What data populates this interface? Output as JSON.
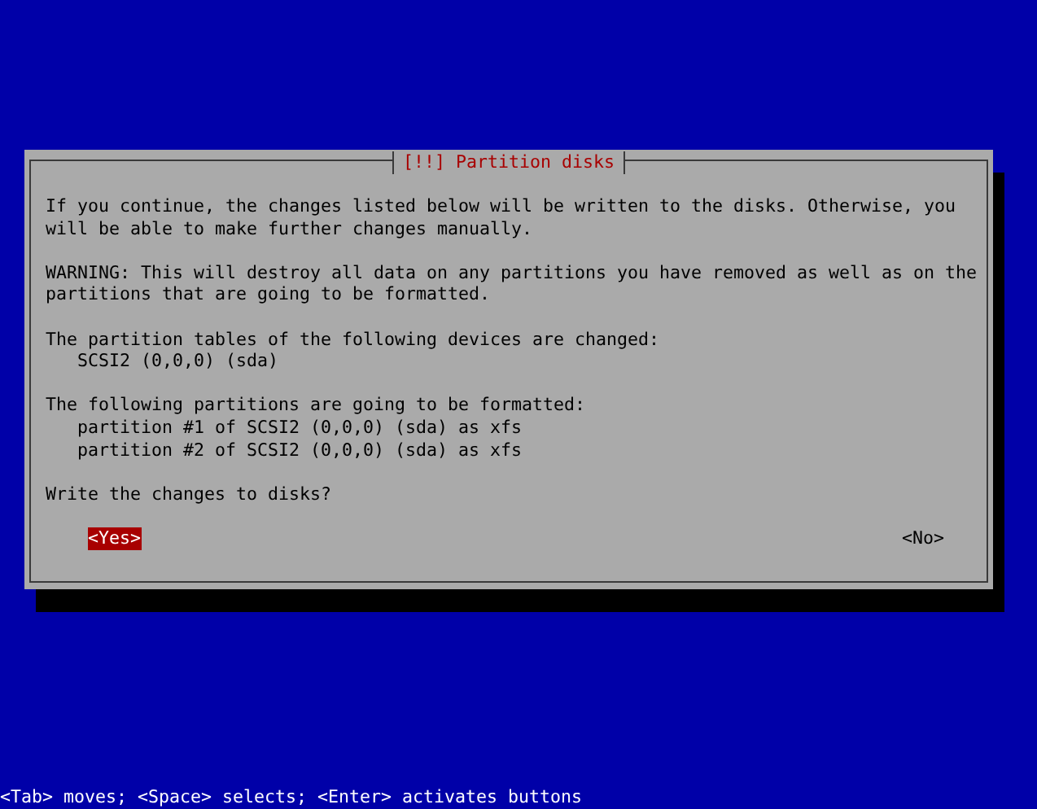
{
  "dialog": {
    "title": "[!!] Partition disks",
    "paragraphs": [
      {
        "kind": "text",
        "text": "If you continue, the changes listed below will be written to the disks. Otherwise, you will be able to make further changes manually."
      },
      {
        "kind": "text",
        "text": "WARNING: This will destroy all data on any partitions you have removed as well as on the partitions that are going to be formatted."
      },
      {
        "kind": "list",
        "heading": "The partition tables of the following devices are changed:",
        "items": [
          "SCSI2 (0,0,0) (sda)"
        ]
      },
      {
        "kind": "list",
        "heading": "The following partitions are going to be formatted:",
        "items": [
          "partition #1 of SCSI2 (0,0,0) (sda) as xfs",
          "partition #2 of SCSI2 (0,0,0) (sda) as xfs"
        ]
      },
      {
        "kind": "text",
        "text": "Write the changes to disks?"
      }
    ],
    "buttons": [
      {
        "label": "<Yes>",
        "selected": true
      },
      {
        "label": "<No>",
        "selected": false
      }
    ]
  },
  "help_line": "<Tab> moves; <Space> selects; <Enter> activates buttons"
}
